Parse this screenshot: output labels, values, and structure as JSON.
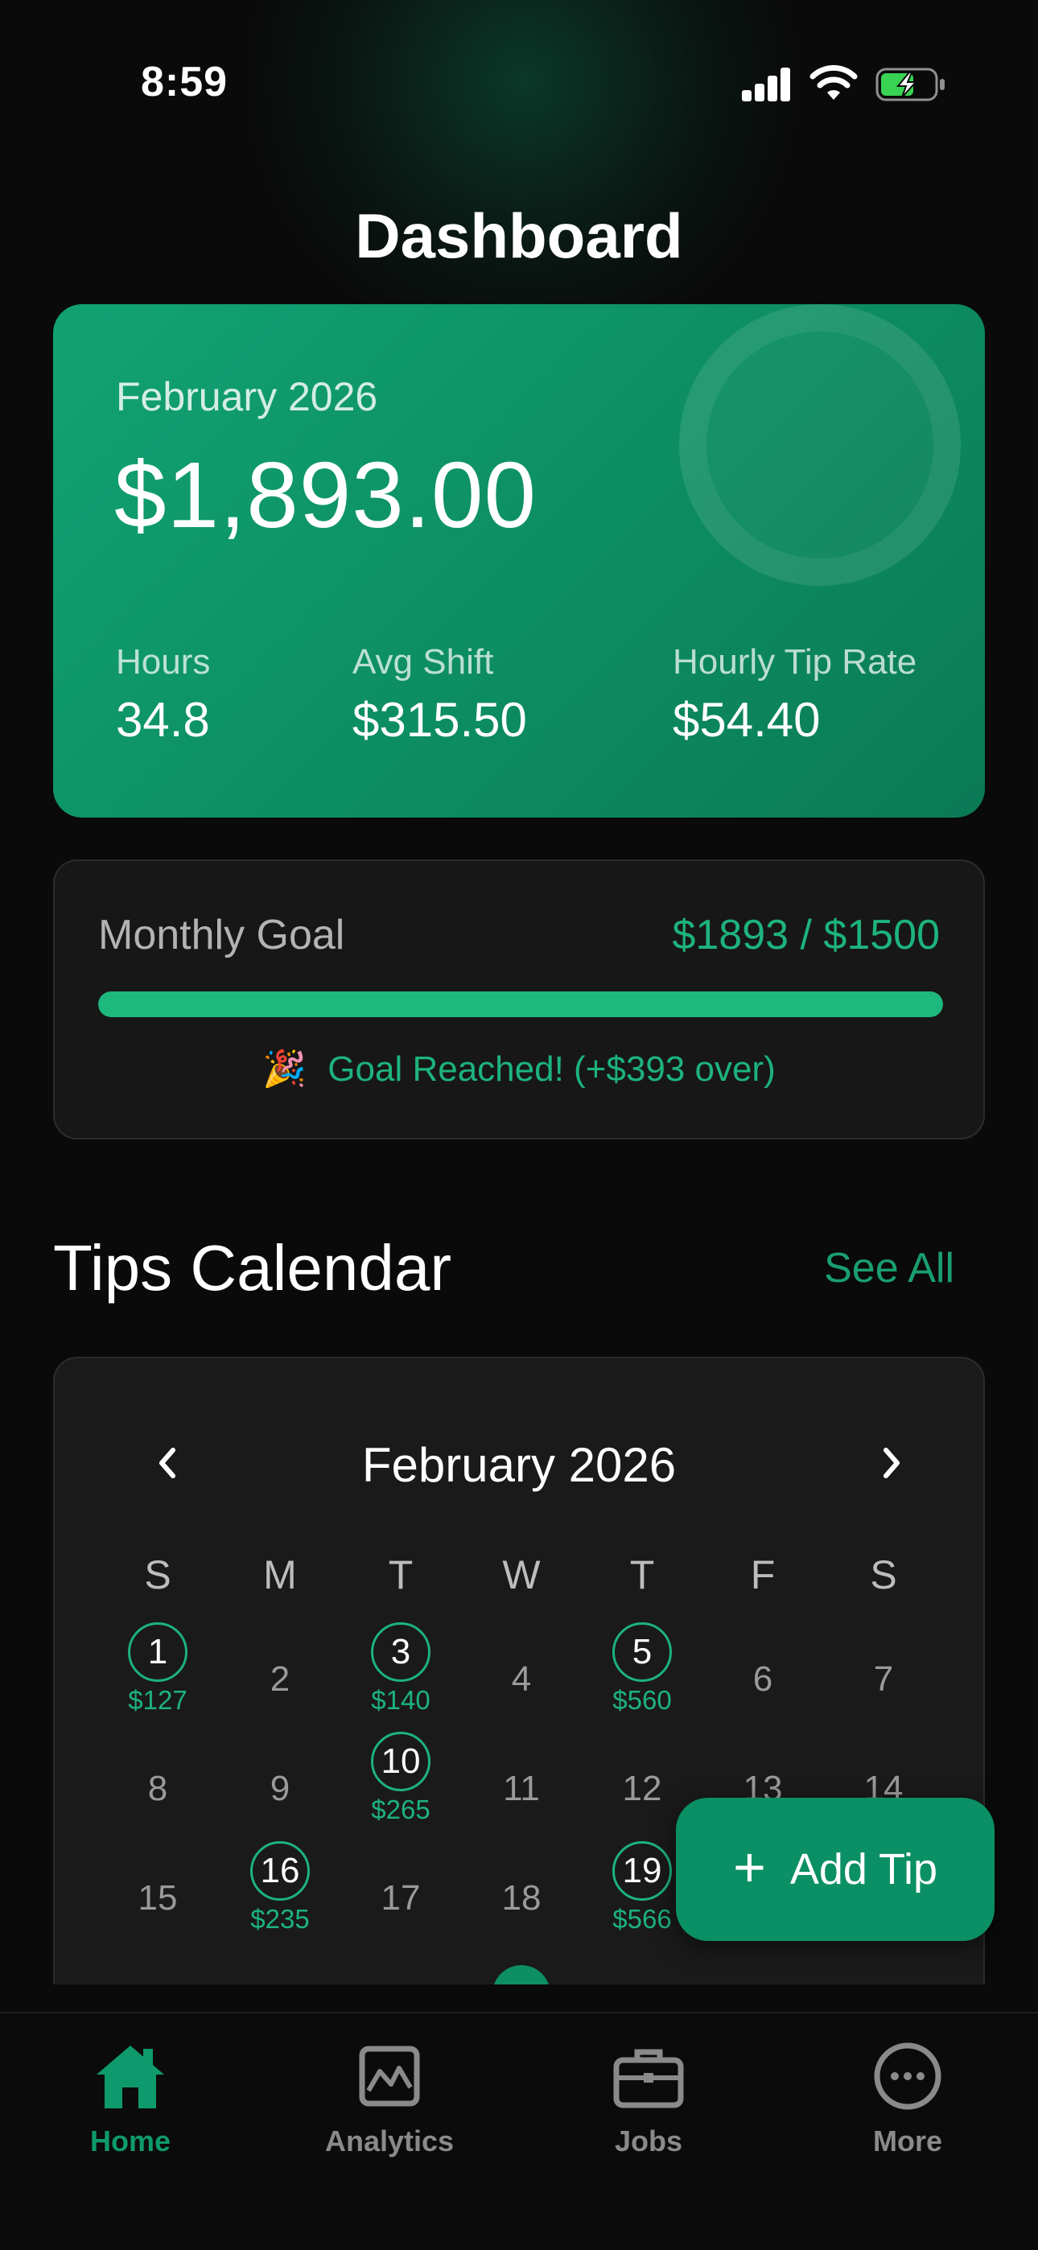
{
  "status_bar": {
    "time": "8:59"
  },
  "header": {
    "title": "Dashboard"
  },
  "summary": {
    "month": "February 2026",
    "total": "$1,893.00",
    "stats": [
      {
        "label": "Hours",
        "value": "34.8"
      },
      {
        "label": "Avg Shift",
        "value": "$315.50"
      },
      {
        "label": "Hourly Tip Rate",
        "value": "$54.40"
      }
    ]
  },
  "goal": {
    "label": "Monthly Goal",
    "amount": "$1893 / $1500",
    "progress": 1.0,
    "status_icon": "party-popper-icon",
    "status_emoji": "🎉",
    "status": "Goal Reached! (+$393 over)"
  },
  "tips_calendar": {
    "title": "Tips Calendar",
    "see_all": "See All",
    "month": "February 2026",
    "weekdays": [
      "S",
      "M",
      "T",
      "W",
      "T",
      "F",
      "S"
    ],
    "days": [
      {
        "day": "1",
        "tip": "$127"
      },
      {
        "day": "2",
        "tip": ""
      },
      {
        "day": "3",
        "tip": "$140"
      },
      {
        "day": "4",
        "tip": ""
      },
      {
        "day": "5",
        "tip": "$560"
      },
      {
        "day": "6",
        "tip": ""
      },
      {
        "day": "7",
        "tip": ""
      },
      {
        "day": "8",
        "tip": ""
      },
      {
        "day": "9",
        "tip": ""
      },
      {
        "day": "10",
        "tip": "$265"
      },
      {
        "day": "11",
        "tip": ""
      },
      {
        "day": "12",
        "tip": ""
      },
      {
        "day": "13",
        "tip": ""
      },
      {
        "day": "14",
        "tip": ""
      },
      {
        "day": "15",
        "tip": ""
      },
      {
        "day": "16",
        "tip": "$235"
      },
      {
        "day": "17",
        "tip": ""
      },
      {
        "day": "18",
        "tip": ""
      },
      {
        "day": "19",
        "tip": "$566"
      }
    ]
  },
  "fab": {
    "label": "Add Tip"
  },
  "tabs": [
    {
      "label": "Home",
      "icon": "home-icon",
      "active": true
    },
    {
      "label": "Analytics",
      "icon": "analytics-icon",
      "active": false
    },
    {
      "label": "Jobs",
      "icon": "briefcase-icon",
      "active": false
    },
    {
      "label": "More",
      "icon": "more-icon",
      "active": false
    }
  ],
  "colors": {
    "accent": "#0e9a6c",
    "accent_light": "#1db37d",
    "card_gradient_start": "#12a373",
    "background": "#0a0a0a"
  }
}
